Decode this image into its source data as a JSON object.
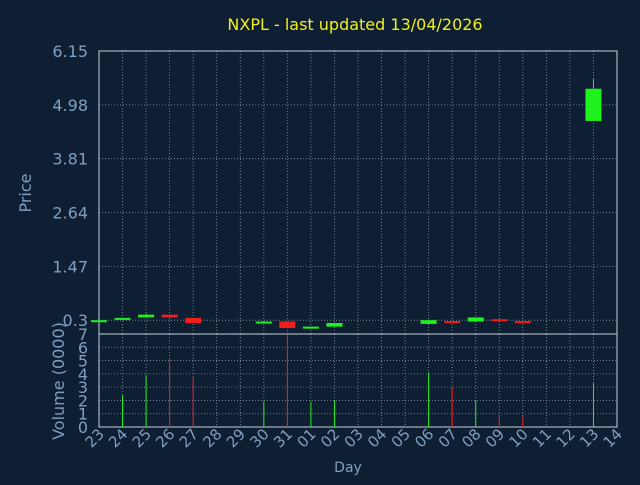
{
  "title": "NXPL - last updated 13/04/2026",
  "colors": {
    "background": "#0f1f33",
    "grid": "#8a9aa8",
    "axis_text": "#7f9fc0",
    "title": "#f0f01e",
    "up": "#1ef21e",
    "down": "#f21e1e"
  },
  "chart_data": [
    {
      "type": "candlestick",
      "title": "NXPL - last updated 13/04/2026",
      "ylabel": "Price",
      "ylim": [
        0,
        6.15
      ],
      "yticks": [
        "6.15",
        "4.98",
        "3.81",
        "2.64",
        "1.47",
        "0.3"
      ],
      "grid": true,
      "categories": [
        "23",
        "24",
        "25",
        "26",
        "27",
        "28",
        "29",
        "30",
        "31",
        "01",
        "02",
        "03",
        "04",
        "05",
        "06",
        "07",
        "08",
        "09",
        "10",
        "11",
        "12",
        "13",
        "14"
      ],
      "candles": [
        {
          "day": "23",
          "open": 0.27,
          "close": 0.3,
          "high": 0.3,
          "low": 0.27
        },
        {
          "day": "24",
          "open": 0.31,
          "close": 0.35,
          "high": 0.35,
          "low": 0.31
        },
        {
          "day": "25",
          "open": 0.36,
          "close": 0.42,
          "high": 0.44,
          "low": 0.36
        },
        {
          "day": "26",
          "open": 0.42,
          "close": 0.36,
          "high": 0.42,
          "low": 0.35
        },
        {
          "day": "27",
          "open": 0.35,
          "close": 0.24,
          "high": 0.35,
          "low": 0.24
        },
        {
          "day": "30",
          "open": 0.24,
          "close": 0.27,
          "high": 0.28,
          "low": 0.24
        },
        {
          "day": "31",
          "open": 0.27,
          "close": 0.13,
          "high": 0.27,
          "low": 0.12
        },
        {
          "day": "01",
          "open": 0.13,
          "close": 0.16,
          "high": 0.16,
          "low": 0.12
        },
        {
          "day": "02",
          "open": 0.16,
          "close": 0.24,
          "high": 0.24,
          "low": 0.16
        },
        {
          "day": "06",
          "open": 0.22,
          "close": 0.3,
          "high": 0.3,
          "low": 0.22
        },
        {
          "day": "07",
          "open": 0.28,
          "close": 0.25,
          "high": 0.28,
          "low": 0.25
        },
        {
          "day": "08",
          "open": 0.27,
          "close": 0.36,
          "high": 0.36,
          "low": 0.27
        },
        {
          "day": "09",
          "open": 0.32,
          "close": 0.29,
          "high": 0.32,
          "low": 0.29
        },
        {
          "day": "10",
          "open": 0.28,
          "close": 0.26,
          "high": 0.28,
          "low": 0.26
        },
        {
          "day": "13",
          "open": 4.63,
          "close": 5.33,
          "high": 5.54,
          "low": 4.63
        }
      ]
    },
    {
      "type": "bar",
      "xlabel": "Day",
      "ylabel": "Volume (0000)",
      "ylim": [
        0,
        7
      ],
      "yticks": [
        "0",
        "1",
        "2",
        "3",
        "4",
        "5",
        "6",
        "7"
      ],
      "grid": true,
      "categories": [
        "23",
        "24",
        "25",
        "26",
        "27",
        "28",
        "29",
        "30",
        "31",
        "01",
        "02",
        "03",
        "04",
        "05",
        "06",
        "07",
        "08",
        "09",
        "10",
        "11",
        "12",
        "13",
        "14"
      ],
      "values": [
        0,
        2.4,
        3.9,
        5.1,
        3.7,
        0,
        0,
        1.9,
        7.0,
        1.9,
        2.0,
        0,
        0,
        0,
        4.1,
        3.0,
        2.0,
        0.9,
        0.8,
        0,
        0,
        3.3,
        0
      ],
      "direction": [
        "up",
        "up",
        "up",
        "down",
        "down",
        "",
        "",
        "up",
        "down",
        "up",
        "up",
        "",
        "",
        "",
        "up",
        "down",
        "up",
        "down",
        "down",
        "",
        "",
        "up",
        ""
      ]
    }
  ]
}
